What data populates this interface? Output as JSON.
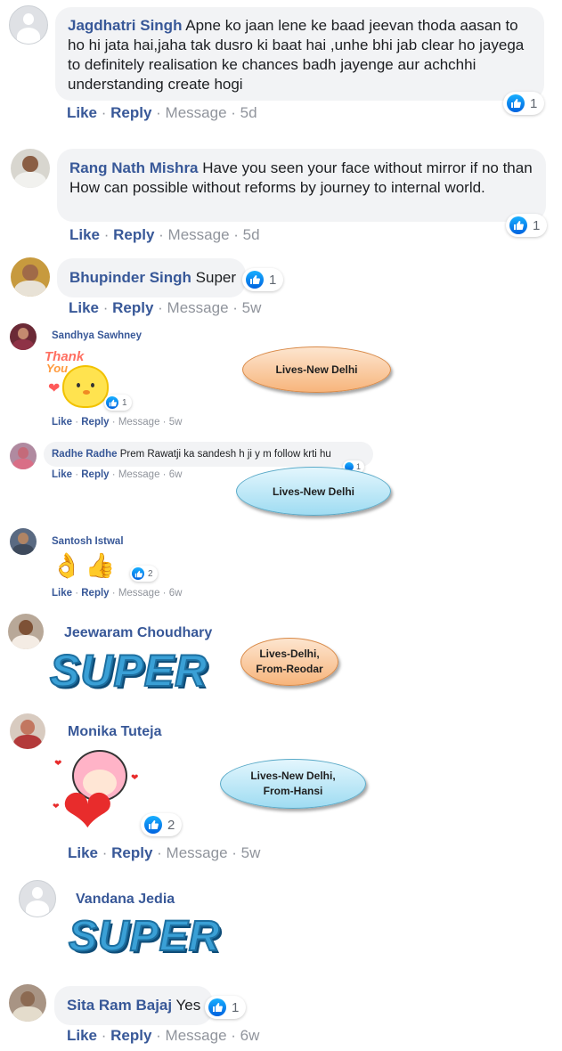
{
  "colors": {
    "name_blue": "#385898",
    "bubble_gray": "#f2f3f5",
    "like_blue": "#1877f2",
    "meta_gray": "#90949c"
  },
  "comments": [
    {
      "name": "Jagdhatri Singh",
      "text": "Apne ko jaan lene ke baad jeevan thoda aasan to ho hi jata hai,jaha tak dusro ki baat hai ,unhe bhi jab clear ho jayega to definitely realisation ke chances badh jayenge aur achchhi understanding create hogi",
      "like": "Like",
      "reply": "Reply",
      "message": "Message",
      "time": "5d",
      "reactions": "1",
      "avatar_icon": "default-avatar-icon"
    },
    {
      "name": "Rang Nath Mishra",
      "text": "Have you seen your face without mirror if no than How can possible without reforms by journey to internal world.",
      "like": "Like",
      "reply": "Reply",
      "message": "Message",
      "time": "5d",
      "reactions": "1",
      "avatar_icon": "user-photo-avatar"
    },
    {
      "name": "Bhupinder Singh",
      "text": "Super",
      "like": "Like",
      "reply": "Reply",
      "message": "Message",
      "time": "5w",
      "reactions": "1",
      "avatar_icon": "user-photo-avatar"
    },
    {
      "name": "Sandhya Sawhney",
      "sticker_text_1": "Thank",
      "sticker_text_2": "You",
      "like": "Like",
      "reply": "Reply",
      "message": "Message",
      "time": "5w",
      "reactions": "1",
      "annotation": "Lives-New Delhi",
      "avatar_icon": "user-photo-avatar"
    },
    {
      "name": "Radhe Radhe",
      "text": "Prem Rawatji ka sandesh h ji y m follow krti hu",
      "like": "Like",
      "reply": "Reply",
      "message": "Message",
      "time": "6w",
      "reactions": "1",
      "annotation": "Lives-New Delhi",
      "avatar_icon": "user-photo-avatar"
    },
    {
      "name": "Santosh Istwal",
      "emojis": "👌👍",
      "like": "Like",
      "reply": "Reply",
      "message": "Message",
      "time": "6w",
      "reactions": "2",
      "avatar_icon": "user-photo-avatar"
    },
    {
      "name": "Jeewaram Choudhary",
      "sticker_text": "SUPER",
      "annotation_line1": "Lives-Delhi,",
      "annotation_line2": "From-Reodar",
      "avatar_icon": "user-photo-avatar"
    },
    {
      "name": "Monika Tuteja",
      "like": "Like",
      "reply": "Reply",
      "message": "Message",
      "time": "5w",
      "reactions": "2",
      "annotation_line1": "Lives-New Delhi,",
      "annotation_line2": "From-Hansi",
      "avatar_icon": "user-photo-avatar"
    },
    {
      "name": "Vandana Jedia",
      "sticker_text": "SUPER",
      "avatar_icon": "default-avatar-icon"
    },
    {
      "name": "Sita Ram Bajaj",
      "text": "Yes",
      "like": "Like",
      "reply": "Reply",
      "message": "Message",
      "time": "6w",
      "reactions": "1",
      "avatar_icon": "user-photo-avatar"
    }
  ]
}
